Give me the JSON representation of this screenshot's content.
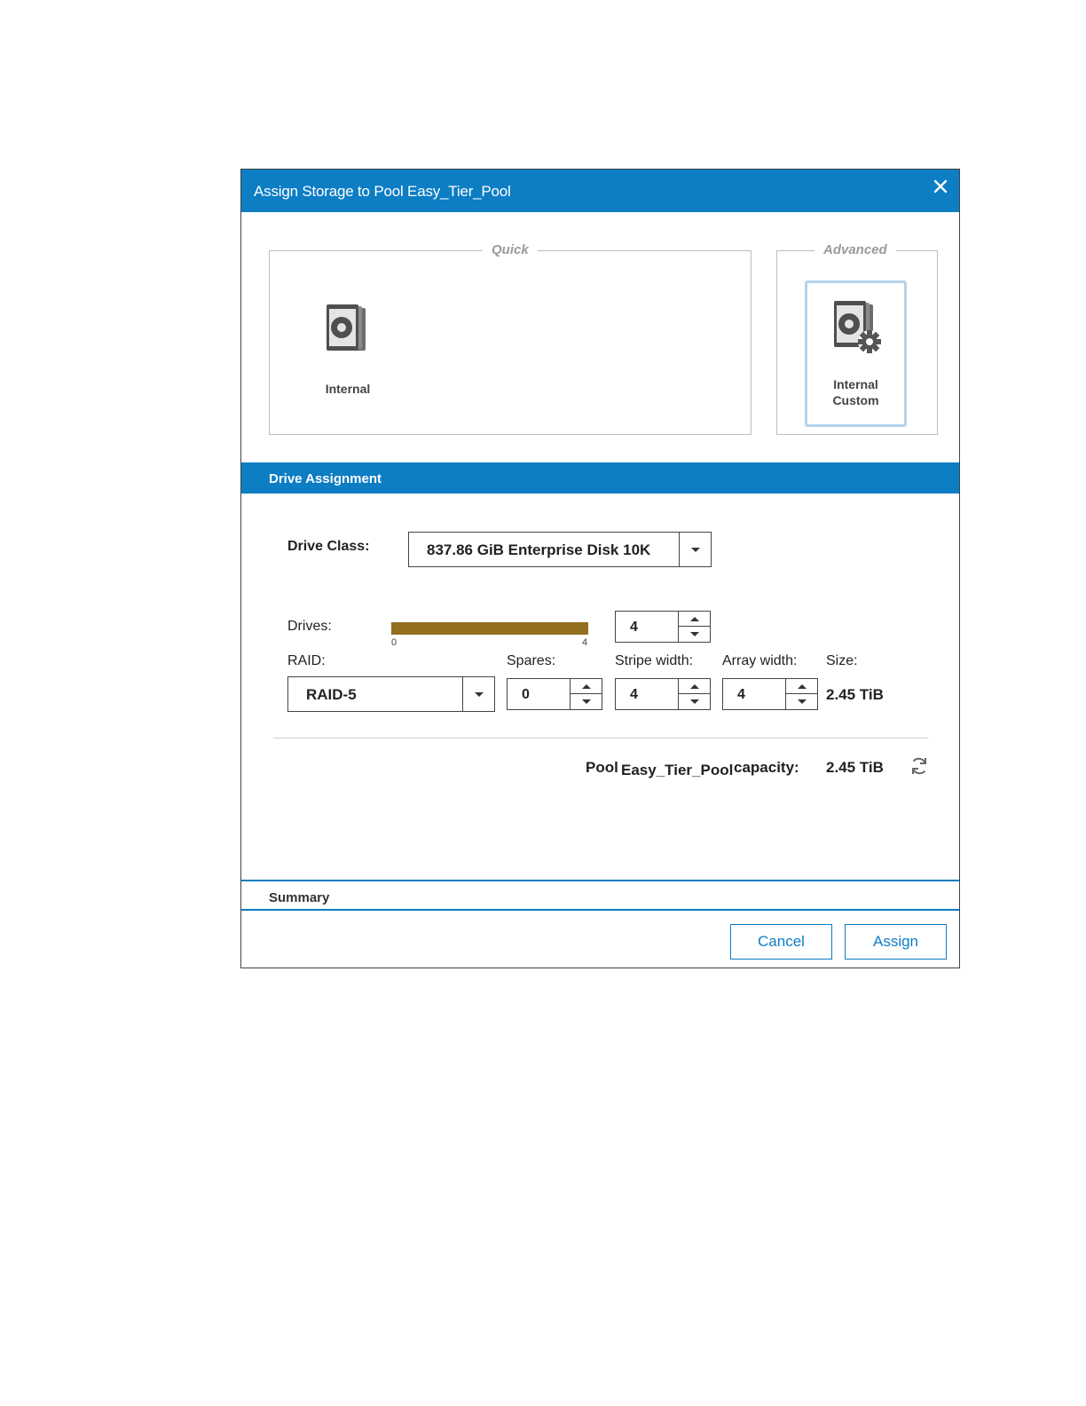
{
  "dialog": {
    "title": "Assign Storage to Pool Easy_Tier_Pool",
    "colors": {
      "accent": "#0d7dc4",
      "slider_fill": "#936e1e"
    }
  },
  "quick": {
    "legend": "Quick",
    "tile_label": "Internal",
    "icon": "hard-disk-icon"
  },
  "advanced": {
    "legend": "Advanced",
    "tile_label_line1": "Internal",
    "tile_label_line2": "Custom",
    "icon": "hard-disk-gear-icon"
  },
  "drive_assignment": {
    "header": "Drive Assignment",
    "drive_class_label": "Drive Class:",
    "drive_class_value": "837.86 GiB Enterprise Disk 10K",
    "drives_label": "Drives:",
    "drives_min": "0",
    "drives_max": "4",
    "drives_value": "4",
    "drives_fill_fraction": 1.0,
    "raid_label": "RAID:",
    "raid_value": "RAID-5",
    "spares_label": "Spares:",
    "spares_value": "0",
    "stripe_label": "Stripe width:",
    "stripe_value": "4",
    "array_label": "Array width:",
    "array_value": "4",
    "size_label": "Size:",
    "size_value": "2.45 TiB",
    "capacity_prefix": "Pool",
    "capacity_pool": "Easy_Tier_Pool",
    "capacity_suffix": "capacity:",
    "capacity_value": "2.45 TiB"
  },
  "summary": {
    "label": "Summary"
  },
  "footer": {
    "cancel_label": "Cancel",
    "assign_label": "Assign"
  }
}
